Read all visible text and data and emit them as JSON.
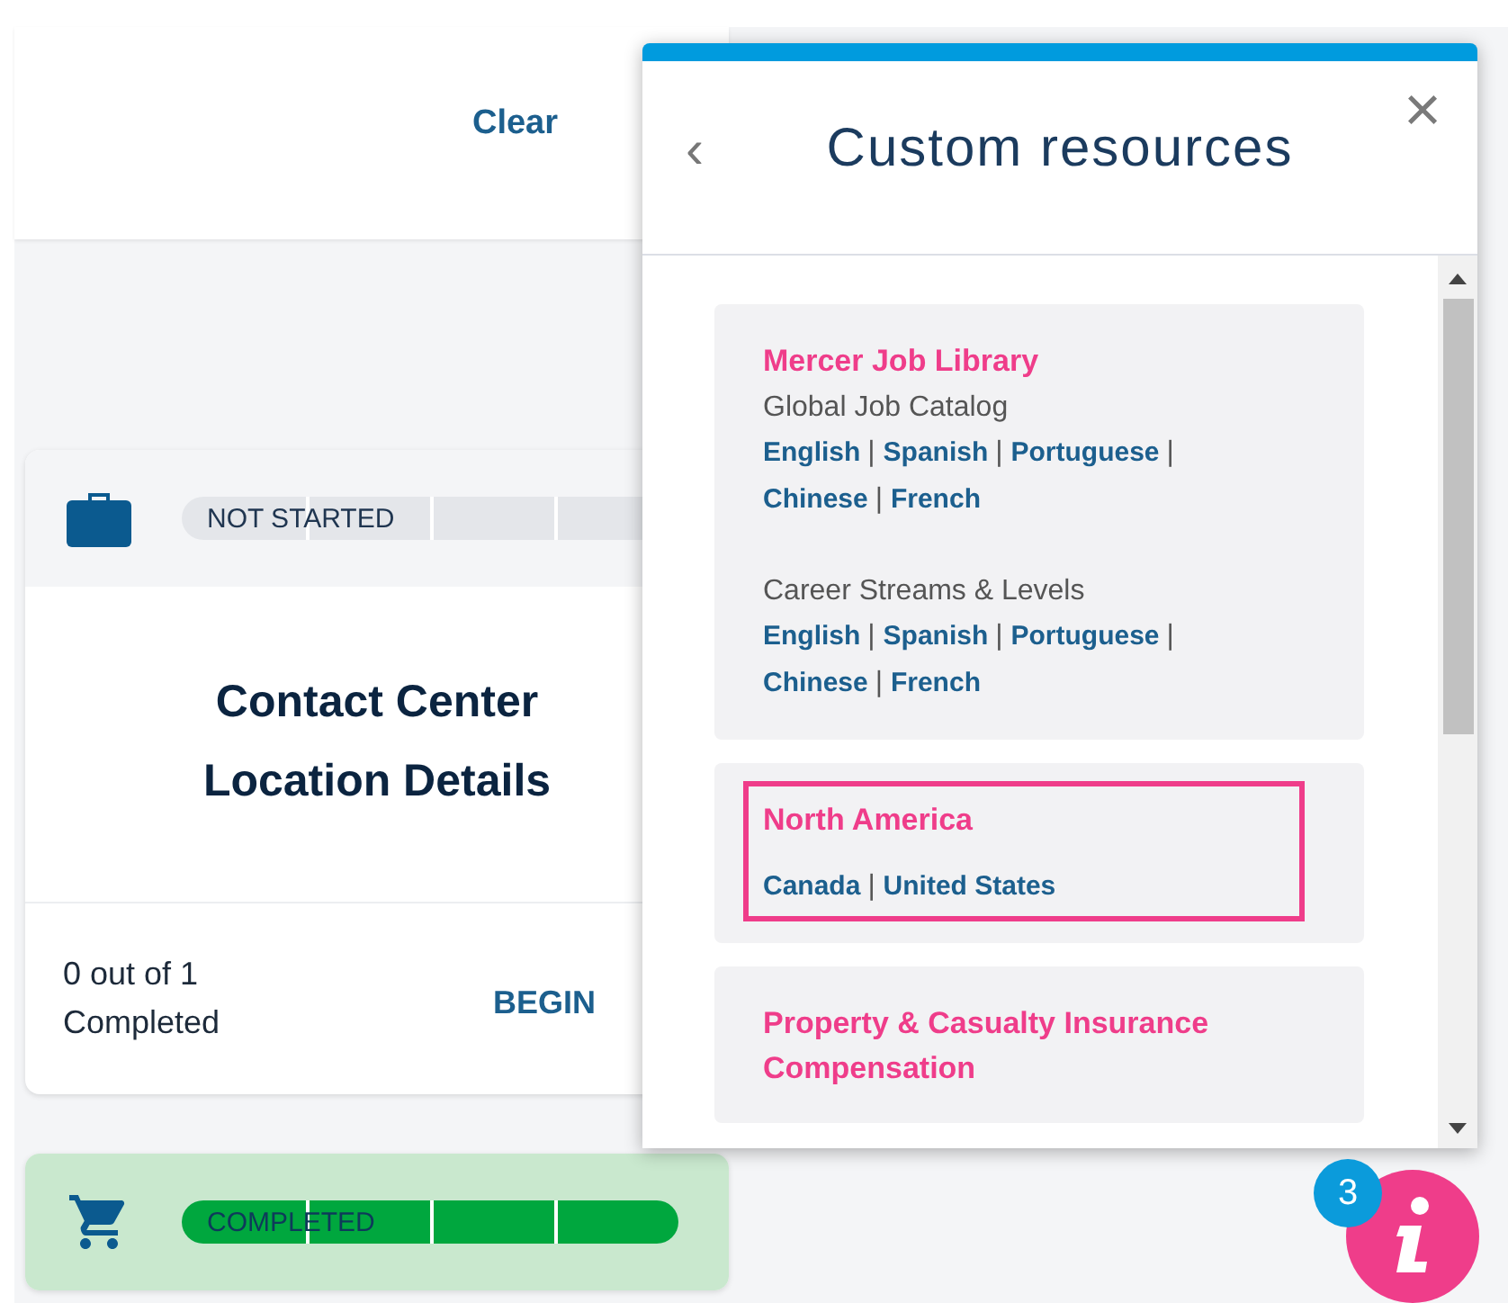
{
  "header": {
    "clear_label": "Clear"
  },
  "cards": [
    {
      "kind": "briefcase",
      "status": "NOT STARTED",
      "completed": false,
      "title": "Contact Center Location Details",
      "progress": "0 out of 1 Completed",
      "action": "BEGIN"
    },
    {
      "kind": "cart",
      "status": "COMPLETED",
      "completed": true
    }
  ],
  "panel": {
    "back": "‹",
    "title": "Custom resources",
    "close": "×",
    "sections": [
      {
        "title": "Mercer Job Library",
        "highlighted": false,
        "groups": [
          {
            "subtitle": "Global Job Catalog",
            "separator": "|",
            "links": [
              "English",
              "Spanish",
              "Portuguese",
              "Chinese",
              "French"
            ]
          },
          {
            "subtitle": "Career Streams & Levels",
            "separator": "|",
            "links": [
              "English",
              "Spanish",
              "Portuguese",
              "Chinese",
              "French"
            ]
          }
        ]
      },
      {
        "title": "North America",
        "highlighted": true,
        "groups": [
          {
            "separator": "|",
            "links": [
              "Canada",
              "United States"
            ]
          }
        ]
      },
      {
        "title": "Property & Casualty Insurance Compensation",
        "highlighted": false
      }
    ]
  },
  "info_button": {
    "badge": "3"
  }
}
